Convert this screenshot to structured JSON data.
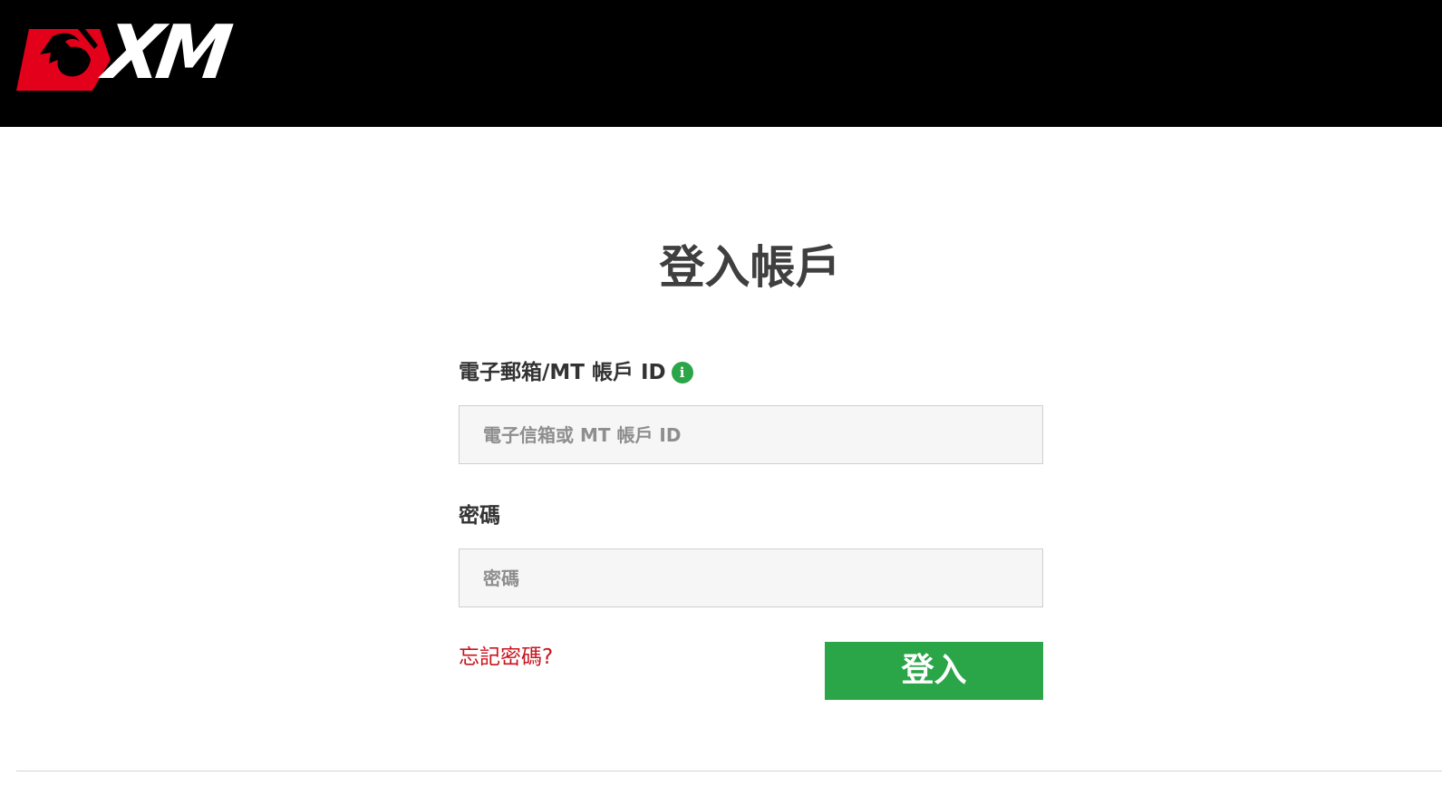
{
  "header": {
    "logo_text": "XM",
    "background": "#000000",
    "logo_accent": "#e2001a"
  },
  "page": {
    "title": "登入帳戶"
  },
  "form": {
    "account_label": "電子郵箱/MT 帳戶 ID",
    "account_info_icon": "info-icon",
    "account_info_glyph": "i",
    "account_placeholder": "電子信箱或 MT 帳戶 ID",
    "account_value": "",
    "password_label": "密碼",
    "password_placeholder": "密碼",
    "password_value": "",
    "forgot_link": "忘記密碼?",
    "submit_label": "登入"
  },
  "colors": {
    "primary_green": "#2aa548",
    "link_red": "#c8141e",
    "text_dark": "#333333"
  }
}
